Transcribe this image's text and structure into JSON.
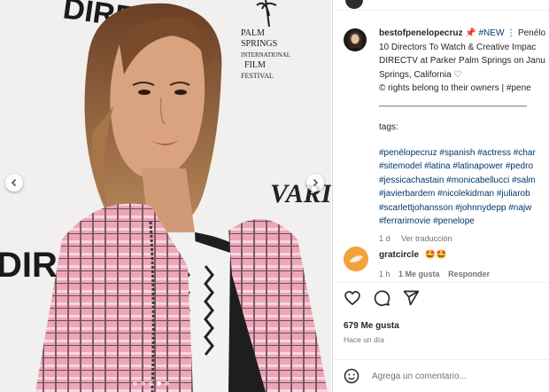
{
  "post": {
    "username": "bestofpenelopecruz",
    "new_tag": "#NEW",
    "caption_lines": [
      "10 Directors To Watch & Creative Impac",
      "DIRECTV at Parker Palm Springs on Janu",
      "Springs, California ♡",
      "© rights belong to their owners | #pene",
      "______________________________"
    ],
    "caption_first_tail": "⋮ Penélo",
    "tags_label": "tags:",
    "hashtag_lines": [
      "#penélopecruz #spanish #actress #char",
      "#sitemodel #latina #latinapower #pedro",
      "#jessicachastain #monicabellucci #salm",
      "#javierbardem #nicolekidman #juliarob",
      "#scarlettjohansson #johnnydepp #najw",
      "#ferrarimovie #penelope"
    ],
    "age": "1 d",
    "see_translation": "Ver traducción"
  },
  "comment": {
    "username": "gratcircle",
    "text": "🤩🤩",
    "age": "1 h",
    "likes": "1 Me gusta",
    "reply": "Responder"
  },
  "stats": {
    "likes": "679 Me gusta",
    "time": "Hace un día"
  },
  "composer": {
    "placeholder": "Agrega un comentario..."
  },
  "photo": {
    "backdrop_text": [
      "DIRECT",
      "PALM",
      "SPRINGS",
      "INTERNATIONAL",
      "FILM",
      "FESTIVAL",
      "VARIETY",
      "DIRECTV"
    ],
    "carousel_count": 5,
    "carousel_active": 3
  },
  "colors": {
    "link": "#00376b",
    "muted": "#737373",
    "text": "#262626",
    "jacket_pink": "#e99ab0"
  },
  "icons": [
    "chevron-left-icon",
    "chevron-right-icon",
    "heart-icon",
    "comment-icon",
    "share-icon",
    "emoji-icon",
    "pin-icon"
  ]
}
